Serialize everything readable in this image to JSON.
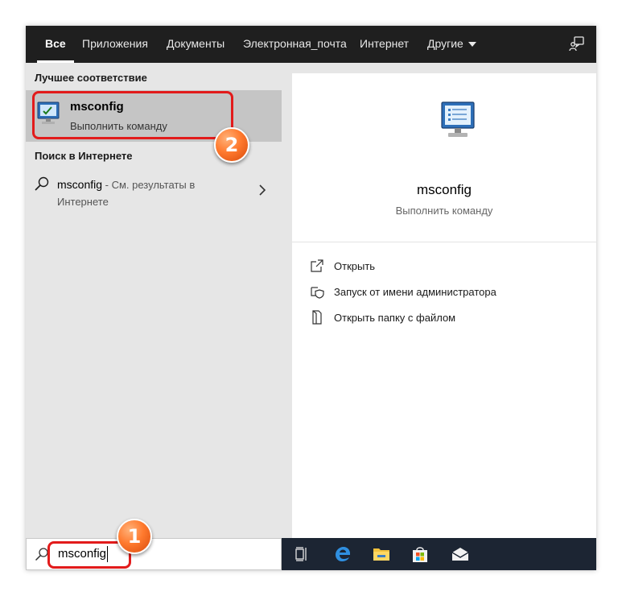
{
  "tabs": [
    {
      "label": "Все",
      "active": true
    },
    {
      "label": "Приложения"
    },
    {
      "label": "Документы"
    },
    {
      "label": "Электронная_почта"
    },
    {
      "label": "Интернет"
    },
    {
      "label": "Другие"
    }
  ],
  "left": {
    "best_match_label": "Лучшее соответствие",
    "best_match": {
      "title": "msconfig",
      "subtitle": "Выполнить команду",
      "icon": "system-config-icon"
    },
    "web_label": "Поиск в Интернете",
    "web_result": {
      "query": "msconfig",
      "hint": " - См. результаты в Интернете"
    }
  },
  "right": {
    "title": "msconfig",
    "subtitle": "Выполнить команду",
    "actions": [
      {
        "label": "Открыть",
        "icon": "open-icon"
      },
      {
        "label": "Запуск от имени администратора",
        "icon": "shield-icon"
      },
      {
        "label": "Открыть папку с файлом",
        "icon": "folder-file-icon"
      }
    ]
  },
  "search": {
    "value": "msconfig"
  },
  "markers": {
    "one": "1",
    "two": "2"
  },
  "colors": {
    "highlight": "#e21b1b",
    "marker": "#ff7a2e",
    "topbar": "#1f1f1f",
    "taskbar": "#1c2533"
  }
}
